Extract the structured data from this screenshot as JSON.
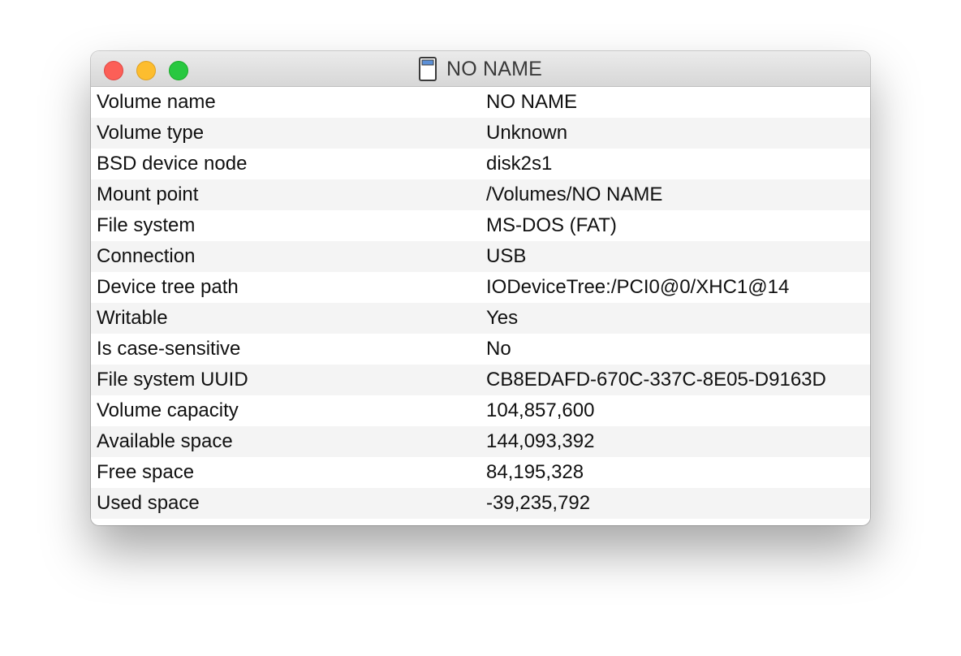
{
  "window": {
    "title": "NO NAME",
    "icon": "sd-card-icon"
  },
  "rows": [
    {
      "key": "Volume name",
      "value": "NO NAME"
    },
    {
      "key": "Volume type",
      "value": "Unknown"
    },
    {
      "key": "BSD device node",
      "value": "disk2s1"
    },
    {
      "key": "Mount point",
      "value": "/Volumes/NO NAME"
    },
    {
      "key": "File system",
      "value": "MS-DOS (FAT)"
    },
    {
      "key": "Connection",
      "value": "USB"
    },
    {
      "key": "Device tree path",
      "value": "IODeviceTree:/PCI0@0/XHC1@14"
    },
    {
      "key": "Writable",
      "value": "Yes"
    },
    {
      "key": "Is case-sensitive",
      "value": "No"
    },
    {
      "key": "File system UUID",
      "value": "CB8EDAFD-670C-337C-8E05-D9163D"
    },
    {
      "key": "Volume capacity",
      "value": "104,857,600"
    },
    {
      "key": "Available space",
      "value": "144,093,392"
    },
    {
      "key": "Free space",
      "value": "84,195,328"
    },
    {
      "key": "Used space",
      "value": "-39,235,792"
    }
  ],
  "colors": {
    "close": "#fc5f57",
    "minimize": "#fdbd2e",
    "zoom": "#28c840",
    "row_alt": "#f4f4f4"
  }
}
